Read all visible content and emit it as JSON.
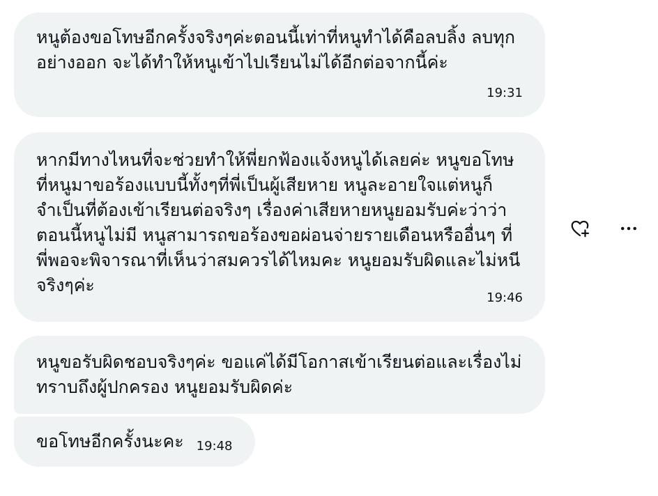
{
  "messages": [
    {
      "text": "หนูต้องขอโทษอีกครั้งจริงๆค่ะตอนนี้เท่าที่หนูทำได้คือลบลิ้ง ลบทุกอย่างออก จะได้ทำให้หนูเข้าไปเรียนไม่ได้อีกต่อจากนี้ค่ะ",
      "time": "19:31"
    },
    {
      "text": "หากมีทางไหนที่จะช่วยทำให้พี่ยกฟ้องแจ้งหนูได้เลยค่ะ หนูขอโทษที่หนูมาขอร้องแบบนี้ทั้งๆที่พี่เป็นผู้เสียหาย หนูละอายใจแต่หนูก็จำเป็นที่ต้องเข้าเรียนต่อจริงๆ เรื่องค่าเสียหายหนูยอมรับค่ะว่าว่าตอนนี้หนูไม่มี หนูสามารถขอร้องขอผ่อนจ่ายรายเดือนหรืออื่นๆ ที่พี่พอจะพิจารณาที่เห็นว่าสมควรได้ไหมคะ หนูยอมรับผิดและไม่หนีจริงๆค่ะ",
      "time": "19:46"
    },
    {
      "text": "หนูขอรับผิดชอบจริงๆค่ะ ขอแค่ได้มีโอกาสเข้าเรียนต่อและเรื่องไม่ทราบถึงผู้ปกครอง หนูยอมรับผิดค่ะ"
    },
    {
      "text": "ขอโทษอีกครั้งนะคะ",
      "time": "19:48"
    }
  ],
  "actions": {
    "react_icon": "heart-plus-icon",
    "more_icon": "more-horizontal-icon",
    "more_glyph": "···"
  },
  "colors": {
    "bubble_bg": "#eff3f4",
    "text": "#0f1419"
  }
}
